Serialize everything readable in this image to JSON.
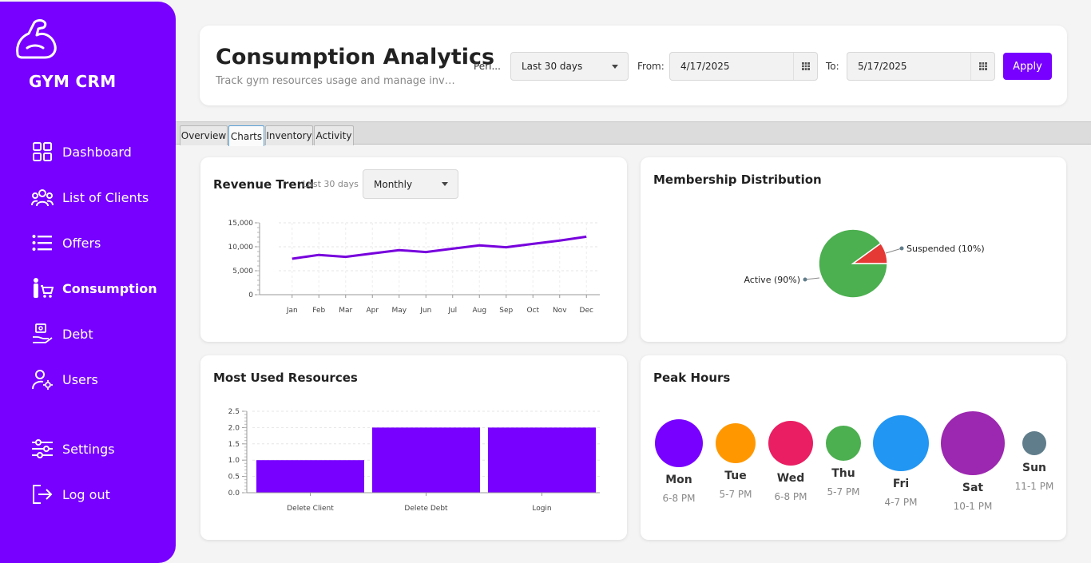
{
  "sidebar": {
    "brand": "GYM CRM",
    "items": [
      {
        "label": "Dashboard",
        "icon": "dashboard-icon"
      },
      {
        "label": "List of Clients",
        "icon": "clients-icon"
      },
      {
        "label": "Offers",
        "icon": "offers-icon"
      },
      {
        "label": "Consumption",
        "icon": "consumption-icon",
        "active": true
      },
      {
        "label": "Debt",
        "icon": "debt-icon"
      },
      {
        "label": "Users",
        "icon": "users-icon"
      },
      {
        "label": "Settings",
        "icon": "settings-icon"
      },
      {
        "label": "Log out",
        "icon": "logout-icon"
      }
    ],
    "color": "#7700ff"
  },
  "header": {
    "title": "Consumption Analytics",
    "subtitle": "Track gym resources usage and manage inventory",
    "period_label": "Peri...",
    "period_value": "Last 30 days",
    "from_label": "From:",
    "from_value": "4/17/2025",
    "to_label": "To:",
    "to_value": "5/17/2025",
    "apply_label": "Apply"
  },
  "tabs": [
    {
      "label": "Overview"
    },
    {
      "label": "Charts",
      "active": true
    },
    {
      "label": "Inventory"
    },
    {
      "label": "Activity"
    }
  ],
  "revenue": {
    "title": "Revenue Trend",
    "subtitle": "Last 30 days",
    "granularity": "Monthly"
  },
  "membership": {
    "title": "Membership Distribution"
  },
  "resources": {
    "title": "Most Used Resources"
  },
  "peak": {
    "title": "Peak Hours",
    "days": [
      {
        "day": "Mon",
        "time": "6-8 PM",
        "color": "#7700ff",
        "size": 60
      },
      {
        "day": "Tue",
        "time": "5-7 PM",
        "color": "#ff9800",
        "size": 50
      },
      {
        "day": "Wed",
        "time": "6-8 PM",
        "color": "#e91e63",
        "size": 56
      },
      {
        "day": "Thu",
        "time": "5-7 PM",
        "color": "#4caf50",
        "size": 44
      },
      {
        "day": "Fri",
        "time": "4-7 PM",
        "color": "#2196f3",
        "size": 70
      },
      {
        "day": "Sat",
        "time": "10-1 PM",
        "color": "#9c27b0",
        "size": 80
      },
      {
        "day": "Sun",
        "time": "11-1 PM",
        "color": "#607d8b",
        "size": 30
      }
    ]
  },
  "chart_data": [
    {
      "type": "line",
      "x": [
        "Jan",
        "Feb",
        "Mar",
        "Apr",
        "May",
        "Jun",
        "Jul",
        "Aug",
        "Sep",
        "Oct",
        "Nov",
        "Dec"
      ],
      "series": [
        {
          "values": [
            7500,
            8300,
            7900,
            8600,
            9300,
            8900,
            9600,
            10300,
            9900,
            10600,
            11300,
            12100
          ]
        }
      ],
      "yticks": [
        "0",
        "5,000",
        "10,000",
        "15,000"
      ],
      "ylim": [
        0,
        15000
      ],
      "grid": true,
      "color": "#7700dd"
    },
    {
      "type": "pie",
      "labels": [
        "Active (90%)",
        "Suspended (10%)"
      ],
      "values": [
        90,
        10
      ],
      "colors": [
        "#4caf50",
        "#e53935"
      ]
    },
    {
      "type": "bar",
      "categories": [
        "Delete Client",
        "Delete Debt",
        "Login"
      ],
      "values": [
        1.0,
        2.0,
        2.0
      ],
      "yticks": [
        "0.0",
        "0.5",
        "1.0",
        "1.5",
        "2.0",
        "2.5"
      ],
      "ylim": [
        0,
        2.5
      ],
      "grid": true,
      "color": "#7700ff"
    }
  ]
}
